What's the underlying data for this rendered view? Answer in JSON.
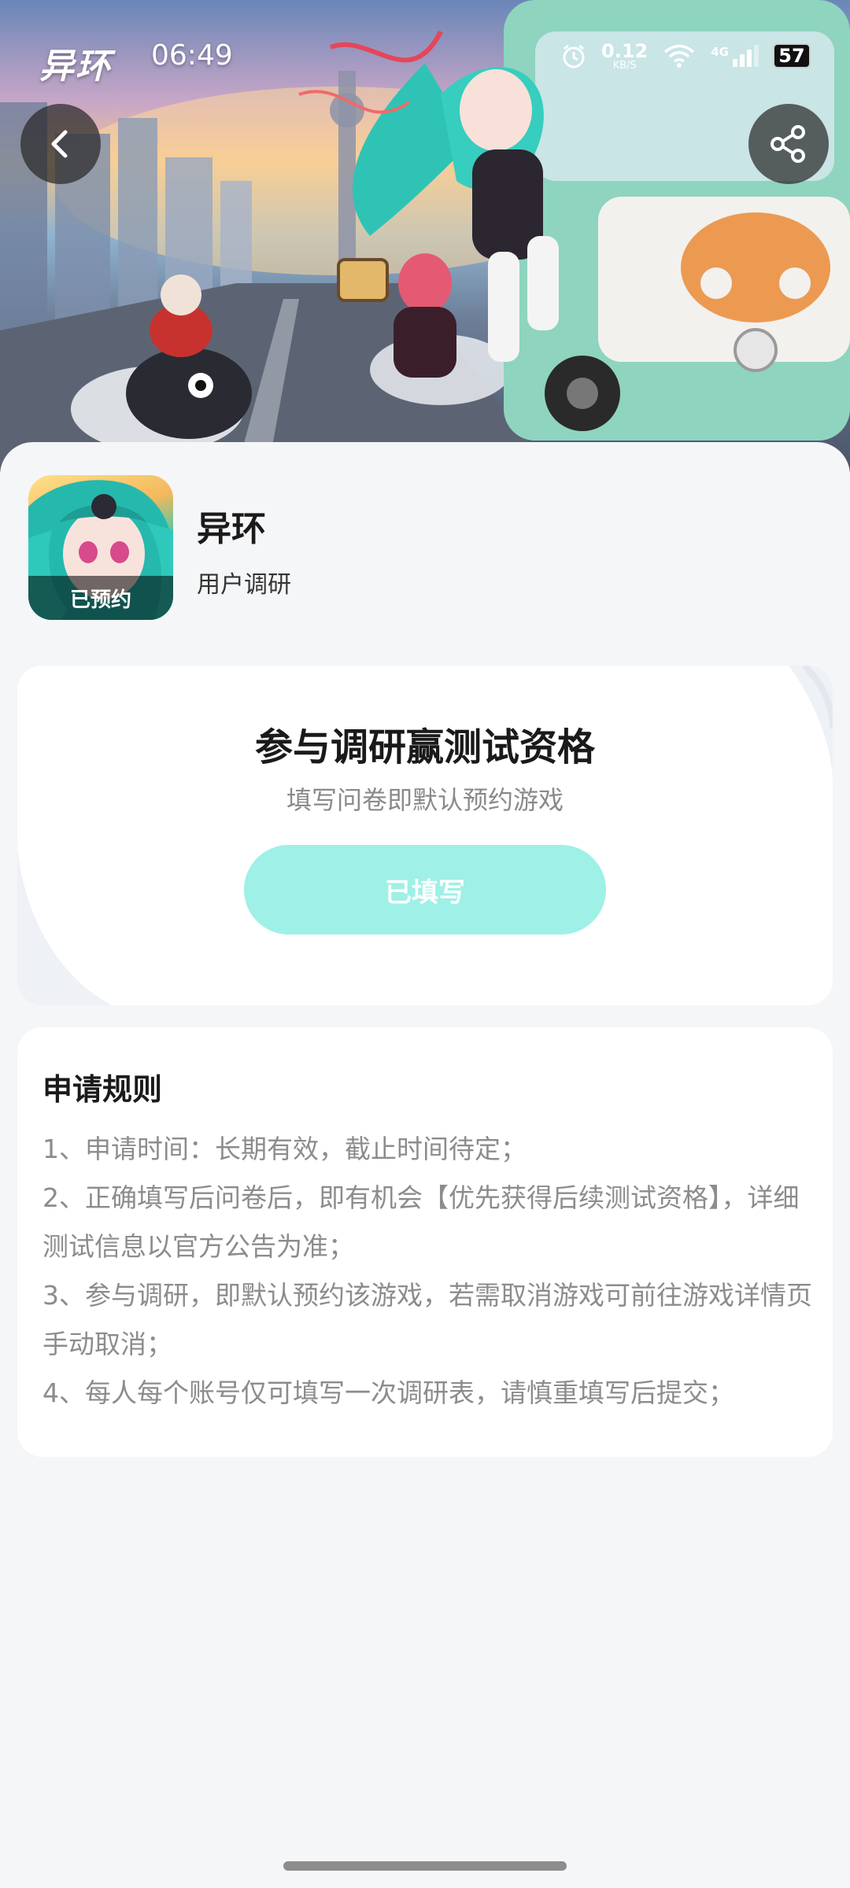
{
  "status_bar": {
    "logo_text": "异环",
    "time": "06:49",
    "net_speed_value": "0.12",
    "net_speed_unit": "KB/S",
    "network": "4G",
    "battery": "57"
  },
  "header": {
    "back_icon": "chevron-left-icon",
    "share_icon": "share-icon"
  },
  "app": {
    "name": "异环",
    "subtitle": "用户调研",
    "icon_badge": "已预约"
  },
  "survey_card": {
    "title": "参与调研赢测试资格",
    "subtitle": "填写问卷即默认预约游戏",
    "button_label": "已填写",
    "button_color": "#9ff0e6"
  },
  "rules": {
    "title": "申请规则",
    "lines": [
      "1、申请时间：长期有效，截止时间待定；",
      "2、正确填写后问卷后，即有机会【优先获得后续测试资格】，详细测试信息以官方公告为准；",
      "3、参与调研，即默认预约该游戏，若需取消游戏可前往游戏详情页手动取消；",
      "4、每人每个账号仅可填写一次调研表，请慎重填写后提交；"
    ]
  }
}
